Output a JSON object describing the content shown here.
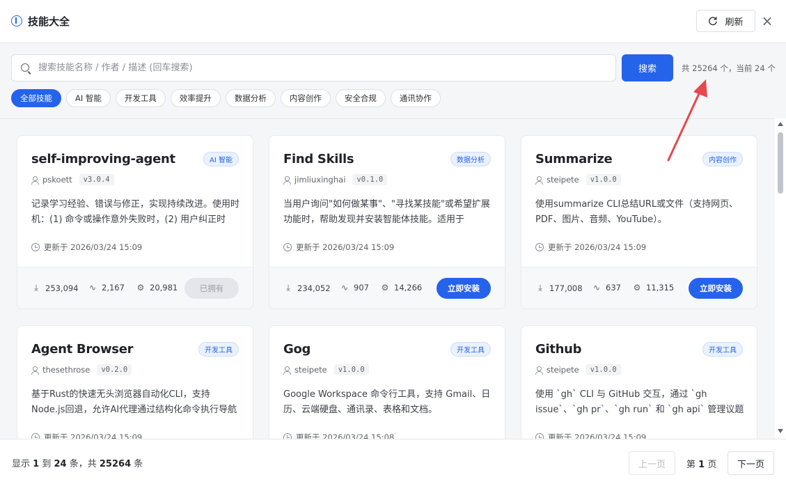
{
  "window": {
    "title": "技能大全",
    "refresh_label": "刷新",
    "close_label": "×"
  },
  "search": {
    "placeholder": "搜索技能名称 / 作者 / 描述 (回车搜索)",
    "value": "",
    "button_label": "搜索",
    "total_text": "共 25264 个，当前 24 个"
  },
  "filters": [
    {
      "label": "全部技能",
      "active": true
    },
    {
      "label": "AI 智能",
      "active": false
    },
    {
      "label": "开发工具",
      "active": false
    },
    {
      "label": "效率提升",
      "active": false
    },
    {
      "label": "数据分析",
      "active": false
    },
    {
      "label": "内容创作",
      "active": false
    },
    {
      "label": "安全合规",
      "active": false
    },
    {
      "label": "通讯协作",
      "active": false
    }
  ],
  "cards": [
    {
      "name": "self-improving-agent",
      "tag": "AI 智能",
      "author": "pskoett",
      "version": "v3.0.4",
      "description": "记录学习经验、错误与修正，实现持续改进。使用时机：(1) 命令或操作意外失败时，(2) 用户纠正时",
      "updated": "更新于 2026/03/24 15:09",
      "downloads": "253,094",
      "activity": "2,167",
      "installs": "20,981",
      "action": "已拥有",
      "owned": true
    },
    {
      "name": "Find Skills",
      "tag": "数据分析",
      "author": "jimliuxinghai",
      "version": "v0.1.0",
      "description": "当用户询问\"如何做某事\"、\"寻找某技能\"或希望扩展功能时，帮助发现并安装智能体技能。适用于",
      "updated": "更新于 2026/03/24 15:09",
      "downloads": "234,052",
      "activity": "907",
      "installs": "14,266",
      "action": "立即安装",
      "owned": false
    },
    {
      "name": "Summarize",
      "tag": "内容创作",
      "author": "steipete",
      "version": "v1.0.0",
      "description": "使用summarize CLI总结URL或文件（支持网页、PDF、图片、音频、YouTube）。",
      "updated": "更新于 2026/03/24 15:09",
      "downloads": "177,008",
      "activity": "637",
      "installs": "11,315",
      "action": "立即安装",
      "owned": false
    },
    {
      "name": "Agent Browser",
      "tag": "开发工具",
      "author": "thesethrose",
      "version": "v0.2.0",
      "description": "基于Rust的快速无头浏览器自动化CLI，支持Node.js回退，允许AI代理通过结构化命令执行导航",
      "updated": "更新于 2026/03/24 15:09",
      "downloads": "",
      "activity": "",
      "installs": "",
      "action": "",
      "owned": false
    },
    {
      "name": "Gog",
      "tag": "开发工具",
      "author": "steipete",
      "version": "v1.0.0",
      "description": "Google Workspace 命令行工具，支持 Gmail、日历、云端硬盘、通讯录、表格和文档。",
      "updated": "更新于 2026/03/24 15:08",
      "downloads": "",
      "activity": "",
      "installs": "",
      "action": "",
      "owned": false
    },
    {
      "name": "Github",
      "tag": "开发工具",
      "author": "steipete",
      "version": "v1.0.0",
      "description": "使用 `gh` CLI 与 GitHub 交互，通过 `gh issue`、`gh pr`、`gh run` 和 `gh api` 管理议题",
      "updated": "更新于 2026/03/24 15:09",
      "downloads": "",
      "activity": "",
      "installs": "",
      "action": "",
      "owned": false
    }
  ],
  "pagination": {
    "info_prefix": "显示",
    "from": "1",
    "mid": "到",
    "to": "24",
    "suffix_a": "条，共",
    "total": "25264",
    "suffix_b": "条",
    "prev_label": "上一页",
    "page_prefix": "第",
    "current_page": "1",
    "page_suffix": "页",
    "next_label": "下一页"
  },
  "colors": {
    "accent": "#2563eb",
    "annotation_arrow": "#e5484d"
  }
}
